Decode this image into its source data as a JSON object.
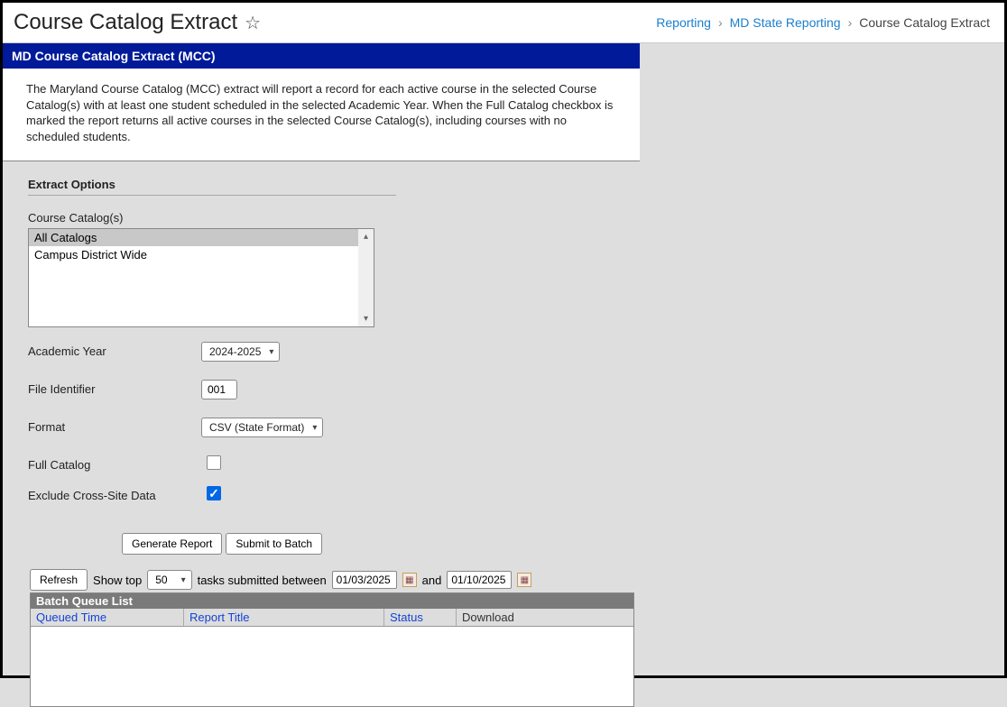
{
  "header": {
    "title": "Course Catalog Extract",
    "breadcrumb": {
      "reporting": "Reporting",
      "state": "MD State Reporting",
      "current": "Course Catalog Extract"
    }
  },
  "section": {
    "title": "MD Course Catalog Extract (MCC)",
    "description": "The Maryland Course Catalog (MCC) extract will report a record for each active course in the selected Course Catalog(s) with at least one student scheduled in the selected Academic Year. When the Full Catalog checkbox is marked the report returns all active courses in the selected Course Catalog(s), including courses with no scheduled students."
  },
  "options": {
    "heading": "Extract Options",
    "catalogs_label": "Course Catalog(s)",
    "catalogs": {
      "items": [
        "All Catalogs",
        "Campus District Wide"
      ],
      "selected_index": 0
    },
    "academic_year": {
      "label": "Academic Year",
      "value": "2024-2025"
    },
    "file_identifier": {
      "label": "File Identifier",
      "value": "001"
    },
    "format": {
      "label": "Format",
      "value": "CSV (State Format)"
    },
    "full_catalog": {
      "label": "Full Catalog",
      "checked": false
    },
    "exclude_cross": {
      "label": "Exclude Cross-Site Data",
      "checked": true
    }
  },
  "actions": {
    "generate": "Generate Report",
    "submit": "Submit to Batch"
  },
  "queue": {
    "refresh": "Refresh",
    "show_top_label": "Show top",
    "show_top_value": "50",
    "between_label": "tasks submitted between",
    "and_label": "and",
    "date_from": "01/03/2025",
    "date_to": "01/10/2025",
    "title": "Batch Queue List",
    "cols": {
      "queued": "Queued Time",
      "report": "Report Title",
      "status": "Status",
      "download": "Download"
    }
  }
}
